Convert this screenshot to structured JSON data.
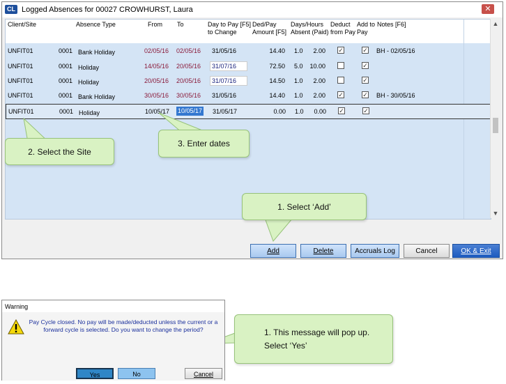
{
  "window": {
    "app_icon": "CL",
    "title": "Logged Absences for 00027     CROWHURST, Laura",
    "close": "✕"
  },
  "columns": {
    "client_site": "Client/Site",
    "absence_type": "Absence Type",
    "from": "From",
    "to": "To",
    "day_to_pay": "Day to Pay [F5] to Change",
    "ded_pay": "Ded/Pay Amount [F5]",
    "days_hours": "Days/Hours Absent (Paid)",
    "deduct": "Deduct from Pay",
    "add_to_pay": "Add to Pay",
    "notes": "Notes [F6]"
  },
  "rows": [
    {
      "client": "UNFIT01",
      "site": "0001",
      "type": "Bank Holiday",
      "from": "02/05/16",
      "to": "02/05/16",
      "day_to_pay": "31/05/16",
      "amount": "14.40",
      "days": "1.0",
      "hours": "2.00",
      "deduct": true,
      "add": true,
      "notes": "BH - 02/05/16"
    },
    {
      "client": "UNFIT01",
      "site": "0001",
      "type": "Holiday",
      "from": "14/05/16",
      "to": "20/05/16",
      "day_to_pay": "31/07/16",
      "amount": "72.50",
      "days": "5.0",
      "hours": "10.00",
      "deduct": false,
      "add": true,
      "notes": ""
    },
    {
      "client": "UNFIT01",
      "site": "0001",
      "type": "Holiday",
      "from": "20/05/16",
      "to": "20/05/16",
      "day_to_pay": "31/07/16",
      "amount": "14.50",
      "days": "1.0",
      "hours": "2.00",
      "deduct": false,
      "add": true,
      "notes": ""
    },
    {
      "client": "UNFIT01",
      "site": "0001",
      "type": "Bank Holiday",
      "from": "30/05/16",
      "to": "30/05/16",
      "day_to_pay": "31/05/16",
      "amount": "14.40",
      "days": "1.0",
      "hours": "2.00",
      "deduct": true,
      "add": true,
      "notes": "BH - 30/05/16"
    },
    {
      "client": "UNFIT01",
      "site": "0001",
      "type": "Holiday",
      "from": "10/05/17",
      "to": "10/05/17",
      "day_to_pay": "31/05/17",
      "amount": "0.00",
      "days": "1.0",
      "hours": "0.00",
      "deduct": true,
      "add": true,
      "notes": ""
    }
  ],
  "buttons": {
    "add": "Add",
    "delete": "Delete",
    "accruals_log": "Accruals Log",
    "cancel": "Cancel",
    "ok_exit": "OK & Exit"
  },
  "callouts": {
    "select_site": "2. Select the Site",
    "enter_dates": "3. Enter dates",
    "select_add": "1. Select ‘Add’",
    "popup": "1. This message will pop up.\nSelect ‘Yes’"
  },
  "dialog": {
    "title": "Warning",
    "message": "Pay Cycle closed. No pay will be made/deducted unless the current or a forward cycle is selected. Do you want to change the period?",
    "yes": "Yes",
    "no": "No",
    "cancel": "Cancel"
  },
  "colors": {
    "grid_bg": "#d4e4f5",
    "callout_bg": "#d9f2c3",
    "from_text": "#8a1a3a",
    "selection": "#3478d0"
  }
}
